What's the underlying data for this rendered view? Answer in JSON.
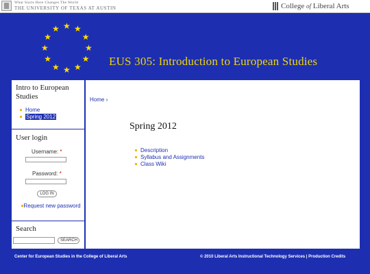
{
  "header": {
    "ut_tagline": "What Starts Here Changes The World",
    "ut_name": "THE UNIVERSITY OF TEXAS AT AUSTIN",
    "college_pre": "College",
    "college_of": "of",
    "college_post": "Liberal Arts",
    "course_title": "EUS 305:  Introduction to European Studies"
  },
  "colors": {
    "background": "#1d2fb0",
    "star": "#ffde00",
    "title": "#f2d500",
    "bullet": "#f0b800"
  },
  "sidebar": {
    "nav_title": "Intro to European Studies",
    "nav_items": [
      {
        "label": "Home",
        "active": false
      },
      {
        "label": "Spring 2012",
        "active": true
      }
    ],
    "login": {
      "title": "User login",
      "username_label": "Username:",
      "password_label": "Password:",
      "required_mark": "*",
      "login_button": "LOG IN",
      "request_password": "Request new password"
    },
    "search": {
      "title": "Search",
      "button": "SEARCH"
    }
  },
  "main": {
    "breadcrumb_home": "Home",
    "breadcrumb_sep": "›",
    "page_title": "Spring 2012",
    "links": [
      "Description",
      "Syllabus and Assignments",
      "Class Wiki"
    ]
  },
  "footer": {
    "left": "Center for European Studies in the College of Liberal Arts",
    "right": "© 2010 Liberal Arts Instructional Technology Services | Production Credits"
  }
}
